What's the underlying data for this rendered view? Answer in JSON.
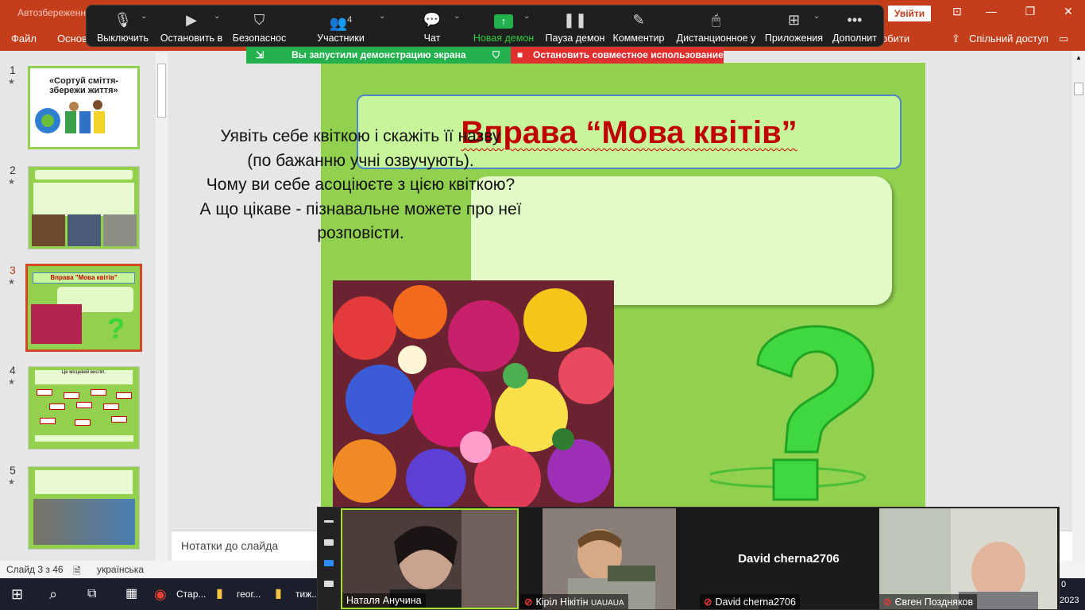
{
  "ppt": {
    "autosave": "Автозбереження",
    "signin": "Увійти",
    "ribbon_file": "Файл",
    "ribbon_home": "Основ",
    "ribbon_tell": "обити",
    "share": "Спільний доступ"
  },
  "zoom": {
    "mute": "Выключить",
    "video": "Остановить в",
    "security": "Безопаснос",
    "participants": "Участники",
    "participants_count": "4",
    "chat": "Чат",
    "share": "Новая демон",
    "pause": "Пауза демон",
    "annotate": "Комментир",
    "remote": "Дистанционное у",
    "apps": "Приложения",
    "more": "Дополнит",
    "share_banner": "Вы запустили демонстрацию экрана",
    "stop_banner": "Остановить совместное использование"
  },
  "slides": [
    {
      "num": "1",
      "title": "«Сортуй сміття- збережи життя»"
    },
    {
      "num": "2"
    },
    {
      "num": "3",
      "title": "Вправа \"Мова квітів\""
    },
    {
      "num": "4",
      "title": "Це місцевий висліп."
    },
    {
      "num": "5"
    }
  ],
  "slide": {
    "title": "Вправа “Мова квітів”",
    "lines": [
      "Уявіть себе квіткою і скажіть її назву",
      "(по бажанню учні озвучують).",
      "Чому ви себе асоціюєте з цією квіткою?",
      "А що цікаве - пізнавальне можете про неї",
      "розповісти."
    ]
  },
  "notes_placeholder": "Нотатки до слайда",
  "status": {
    "slide_counter": "Слайд 3 з 46",
    "language": "українська"
  },
  "taskbar": {
    "chrome": "Стар...",
    "folder1": "геог...",
    "folder2": "тиж...",
    "clock_year": "2023",
    "clock_top": "0"
  },
  "participants": [
    {
      "name": "Наталя Анучина",
      "muted": false
    },
    {
      "name": "Кіріл Нікітін",
      "suffix": "UAUAUA",
      "muted": true
    },
    {
      "name": "David cherna2706",
      "muted": true,
      "center": "David cherna2706"
    },
    {
      "name": "Євген Поздняков",
      "muted": true
    }
  ],
  "colors": {
    "ppt_accent": "#c43e1c",
    "slide_bg": "#92d050",
    "title_red": "#c00000",
    "zoom_green": "#22b14c",
    "zoom_red": "#e02f2f"
  }
}
